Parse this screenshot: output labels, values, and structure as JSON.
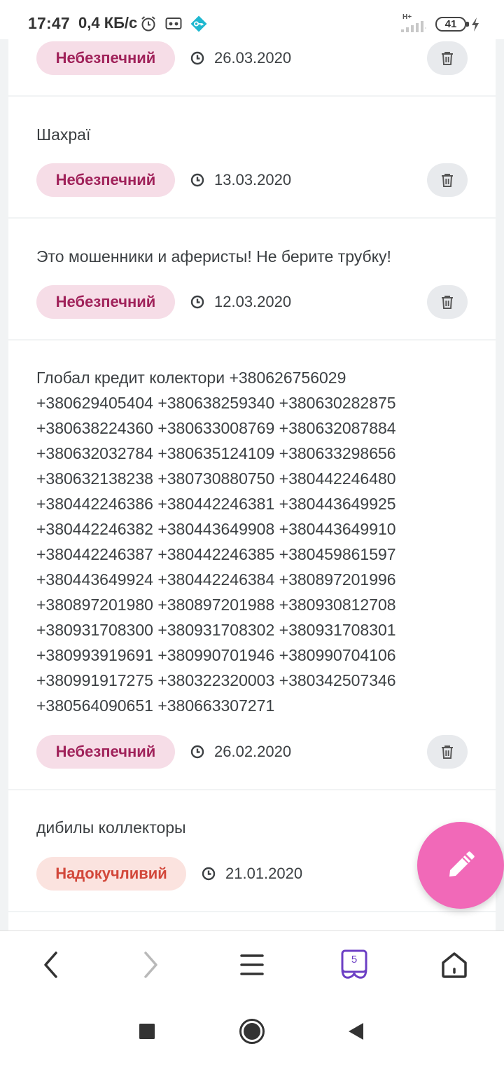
{
  "status_bar": {
    "time": "17:47",
    "speed": "0,4 КБ/с",
    "network_type": "H+",
    "battery": "41",
    "icons": [
      "alarm-icon",
      "vr-icon",
      "vpn-key-icon",
      "signal-icon",
      "battery-icon",
      "charging-icon"
    ]
  },
  "colors": {
    "danger_bg": "#f6dde7",
    "danger_text": "#a0225a",
    "annoying_bg": "#fbe3df",
    "annoying_text": "#d2473a",
    "fab": "#f169b8",
    "tabs_accent": "#6c3fc4"
  },
  "reviews": [
    {
      "text": "",
      "rating": "Небезпечний",
      "rating_type": "danger",
      "date": "26.03.2020",
      "has_delete": true
    },
    {
      "text": "Шахраї",
      "rating": "Небезпечний",
      "rating_type": "danger",
      "date": "13.03.2020",
      "has_delete": true
    },
    {
      "text": "Это мошенники и аферисты! Не берите трубку!",
      "rating": "Небезпечний",
      "rating_type": "danger",
      "date": "12.03.2020",
      "has_delete": true
    },
    {
      "text": "Глобал кредит колектори +380626756029\n+380629405404 +380638259340 +380630282875\n+380638224360 +380633008769 +380632087884\n+380632032784 +380635124109 +380633298656\n+380632138238 +380730880750 +380442246480\n+380442246386 +380442246381 +380443649925\n+380442246382 +380443649908 +380443649910\n+380442246387 +380442246385 +380459861597\n+380443649924 +380442246384 +380897201996\n+380897201980 +380897201988 +380930812708\n+380931708300 +380931708302 +380931708301\n+380993919691 +380990701946 +380990704106\n+380991917275 +380322320003 +380342507346\n+380564090651 +380663307271",
      "rating": "Небезпечний",
      "rating_type": "danger",
      "date": "26.02.2020",
      "has_delete": true
    },
    {
      "text": "дибилы коллекторы",
      "rating": "Надокучливий",
      "rating_type": "annoying",
      "date": "21.01.2020",
      "has_delete": false
    }
  ],
  "fab": {
    "icon": "pencil-icon"
  },
  "browser_toolbar": {
    "tabs_count": "5",
    "buttons": [
      "back-icon",
      "forward-icon",
      "menu-icon",
      "tabs-icon",
      "home-icon"
    ]
  },
  "system_nav": {
    "buttons": [
      "recents-icon",
      "home-circle-icon",
      "back-triangle-icon"
    ]
  }
}
